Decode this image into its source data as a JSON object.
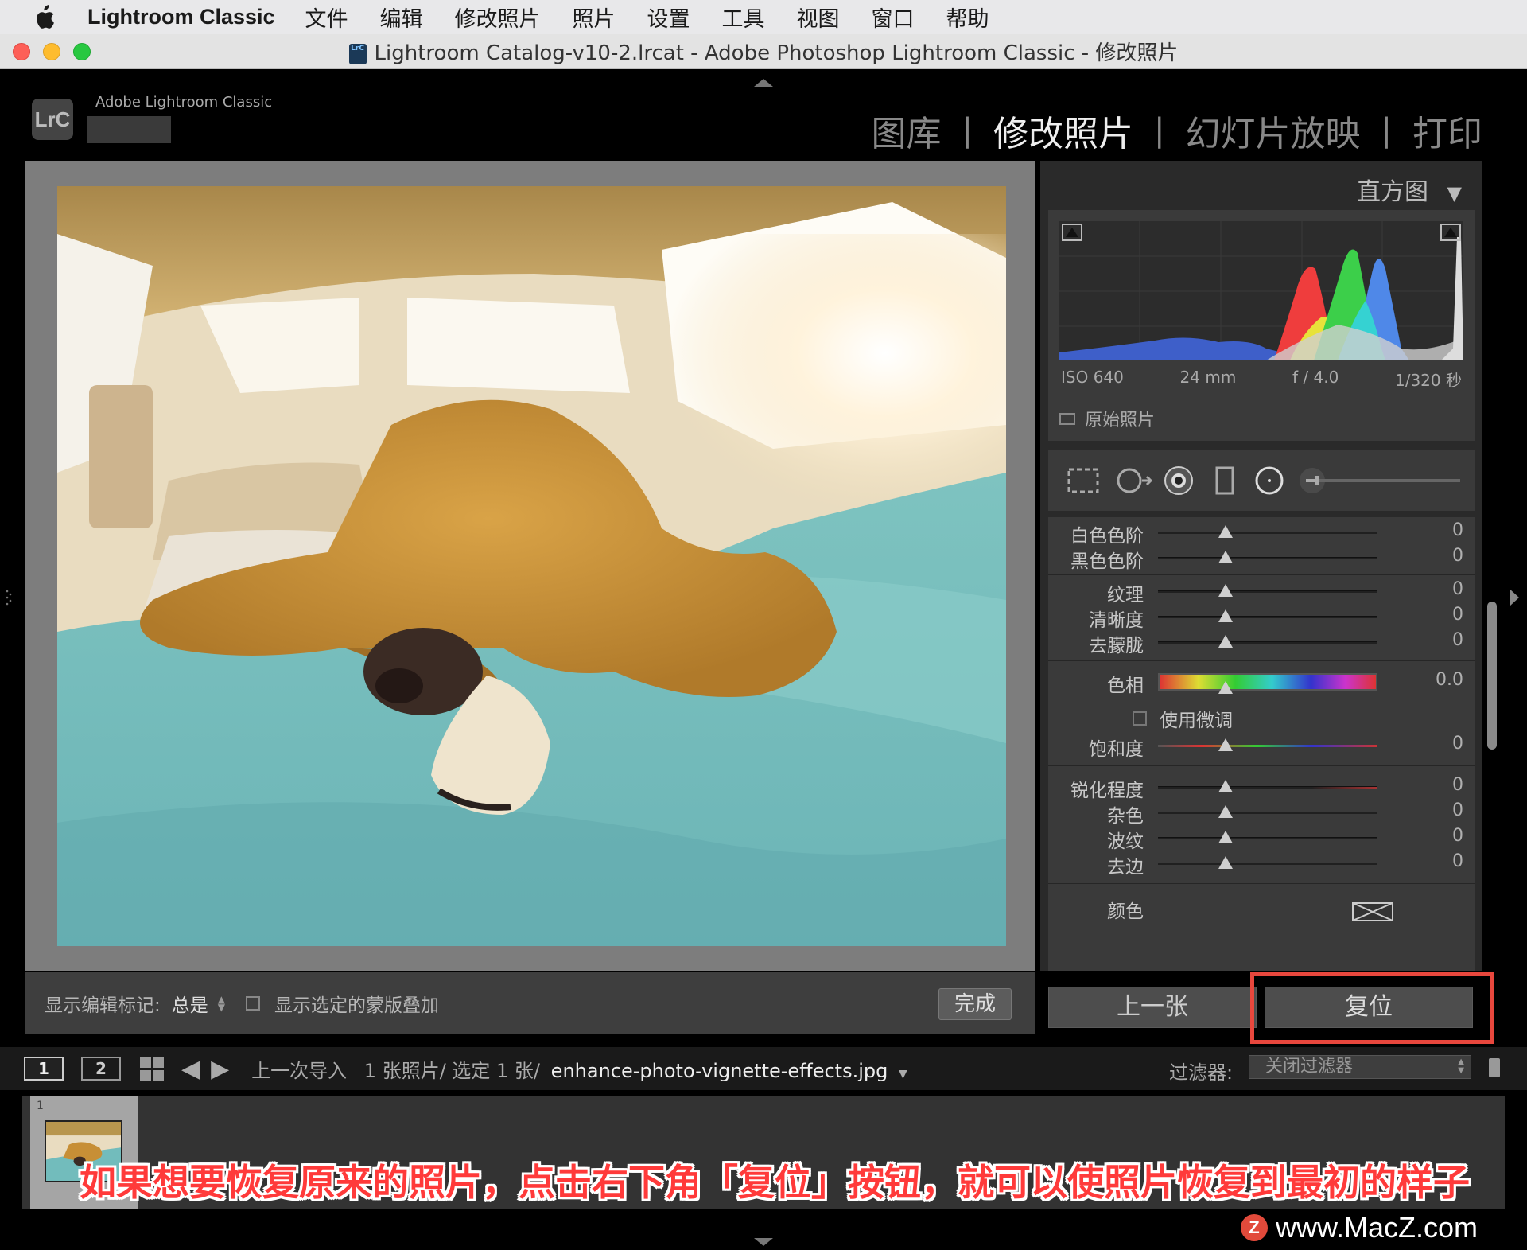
{
  "menubar": {
    "app_name": "Lightroom Classic",
    "items": [
      "文件",
      "编辑",
      "修改照片",
      "照片",
      "设置",
      "工具",
      "视图",
      "窗口",
      "帮助"
    ]
  },
  "window": {
    "title": "Lightroom Catalog-v10-2.lrcat - Adobe Photoshop Lightroom Classic - 修改照片",
    "doc_icon_text": "LrC"
  },
  "topbar": {
    "logo": "LrC",
    "brand": "Adobe Lightroom Classic",
    "modules": [
      {
        "label": "图库",
        "active": false
      },
      {
        "label": "修改照片",
        "active": true
      },
      {
        "label": "幻灯片放映",
        "active": false
      },
      {
        "label": "打印",
        "active": false
      }
    ]
  },
  "image_toolbar": {
    "show_edit_pins_label": "显示编辑标记:",
    "show_edit_pins_value": "总是",
    "show_overlay_label": "显示选定的蒙版叠加",
    "done_label": "完成"
  },
  "histogram": {
    "header": "直方图",
    "iso": "ISO 640",
    "focal": "24 mm",
    "aperture": "f / 4.0",
    "shutter": "1/320 秒",
    "original_photo_label": "原始照片"
  },
  "sliders": {
    "whites": {
      "label": "白色色阶",
      "value": "0"
    },
    "blacks": {
      "label": "黑色色阶",
      "value": "0"
    },
    "texture": {
      "label": "纹理",
      "value": "0"
    },
    "clarity": {
      "label": "清晰度",
      "value": "0"
    },
    "dehaze": {
      "label": "去朦胧",
      "value": "0"
    },
    "hue": {
      "label": "色相",
      "value": "0.0"
    },
    "fine_adjust": {
      "label": "使用微调"
    },
    "saturation": {
      "label": "饱和度",
      "value": "0"
    },
    "sharpness": {
      "label": "锐化程度",
      "value": "0"
    },
    "noise": {
      "label": "杂色",
      "value": "0"
    },
    "moire": {
      "label": "波纹",
      "value": "0"
    },
    "defringe": {
      "label": "去边",
      "value": "0"
    },
    "color": {
      "label": "颜色"
    }
  },
  "buttons": {
    "previous": "上一张",
    "reset": "复位"
  },
  "filmbar": {
    "view1": "1",
    "view2": "2",
    "source": "上一次导入",
    "count": "1 张照片/ 选定 1 张/",
    "filename": "enhance-photo-vignette-effects.jpg",
    "filter_label": "过滤器:",
    "filter_value": "关闭过滤器"
  },
  "filmstrip": {
    "thumb_index": "1"
  },
  "caption": "如果想要恢复原来的照片，点击右下角「复位」按钮，就可以使照片恢复到最初的样子",
  "watermark": {
    "logo": "Z",
    "text": "www.MacZ.com"
  },
  "colors": {
    "highlight": "#e8473d",
    "caption": "#ff3a3a",
    "panel_bg": "#3a3a3a"
  }
}
